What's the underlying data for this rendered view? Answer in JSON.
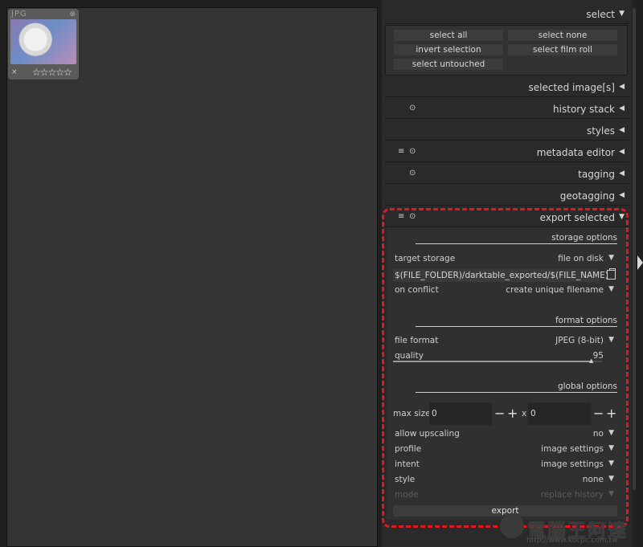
{
  "lighttable": {
    "thumbnail": {
      "extension": "JPG",
      "stars": "☆☆☆☆☆",
      "reject": "×",
      "close": "⊗"
    }
  },
  "panel": {
    "select": {
      "title": "select",
      "buttons": [
        "select all",
        "select none",
        "invert selection",
        "select film roll",
        "select untouched"
      ]
    },
    "modules": {
      "selected_images": "selected image[s]",
      "history_stack": "history stack",
      "styles": "styles",
      "metadata_editor": "metadata editor",
      "tagging": "tagging",
      "geotagging": "geotagging",
      "export_selected": "export selected"
    },
    "icons": {
      "presets": "≡",
      "reset": "⊙",
      "expanded": "▼",
      "collapsed": "◀"
    },
    "export": {
      "storage_options": "storage options",
      "target_storage_label": "target storage",
      "target_storage_value": "file on disk",
      "path": "$(FILE_FOLDER)/darktable_exported/$(FILE_NAME)",
      "on_conflict_label": "on conflict",
      "on_conflict_value": "create unique filename",
      "format_options": "format options",
      "file_format_label": "file format",
      "file_format_value": "JPEG (8-bit)",
      "quality_label": "quality",
      "quality_value": "95",
      "global_options": "global options",
      "max_size_label": "max size",
      "width": "0",
      "height": "0",
      "x": "x",
      "minus": "−",
      "plus": "+",
      "allow_upscaling_label": "allow upscaling",
      "allow_upscaling_value": "no",
      "profile_label": "profile",
      "profile_value": "image settings",
      "intent_label": "intent",
      "intent_value": "image settings",
      "style_label": "style",
      "style_value": "none",
      "mode_label": "mode",
      "mode_value": "replace history",
      "export_button": "export",
      "dropdown_arrow": "▼"
    }
  },
  "watermark": {
    "text": "電腦王阿達",
    "url": "http://www.kocpc.com.tw"
  },
  "colors": {
    "highlight": "#e41820",
    "panel_bg": "#2a2a2a",
    "lighttable_bg": "#333333"
  }
}
